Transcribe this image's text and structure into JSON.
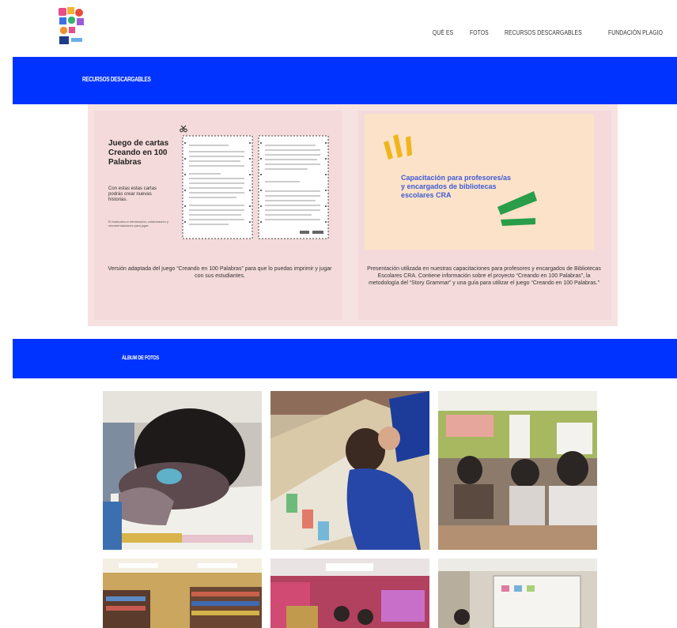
{
  "nav": {
    "items": [
      "QUÉ ES",
      "FOTOS",
      "RECURSOS DESCARGABLES",
      "FUNDACIÓN PLAGIO"
    ]
  },
  "sections": {
    "resources_title": "RECURSOS DESCARGABLES",
    "album_title": "ÁLBUM DE FOTOS"
  },
  "cards": [
    {
      "title": "Juego de cartas Creando en 100 Palabras",
      "subtitle": "Con estas estas cartas podrás crear nuevas historias.",
      "small_print": "El instructivo e información, colaboración y recomendaciones para jugar.",
      "caption": "Versión adaptada del juego “Creando en 100 Palabras” para que lo puedas imprimir y jugar con sus estudiantes."
    },
    {
      "title": "Capacitación para profesores/as y encargados de bibliotecas escolares CRA",
      "caption": "Presentación utilizada en nuestras capacitaciones para profesores y encargados de Bibliotecas Escolares CRA. Contiene información sobre el proyecto “Creando en 100 Palabras”, la metodología del “Story Grammar” y una guía para utilizar el juego “Creando en 100 Palabras.”"
    }
  ],
  "colors": {
    "brand_blue": "#0033ff",
    "card_bg": "#f4dada",
    "cra_title": "#3e5bd6",
    "cra_yellow": "#f0b51c",
    "cra_green": "#2a9d4a"
  }
}
